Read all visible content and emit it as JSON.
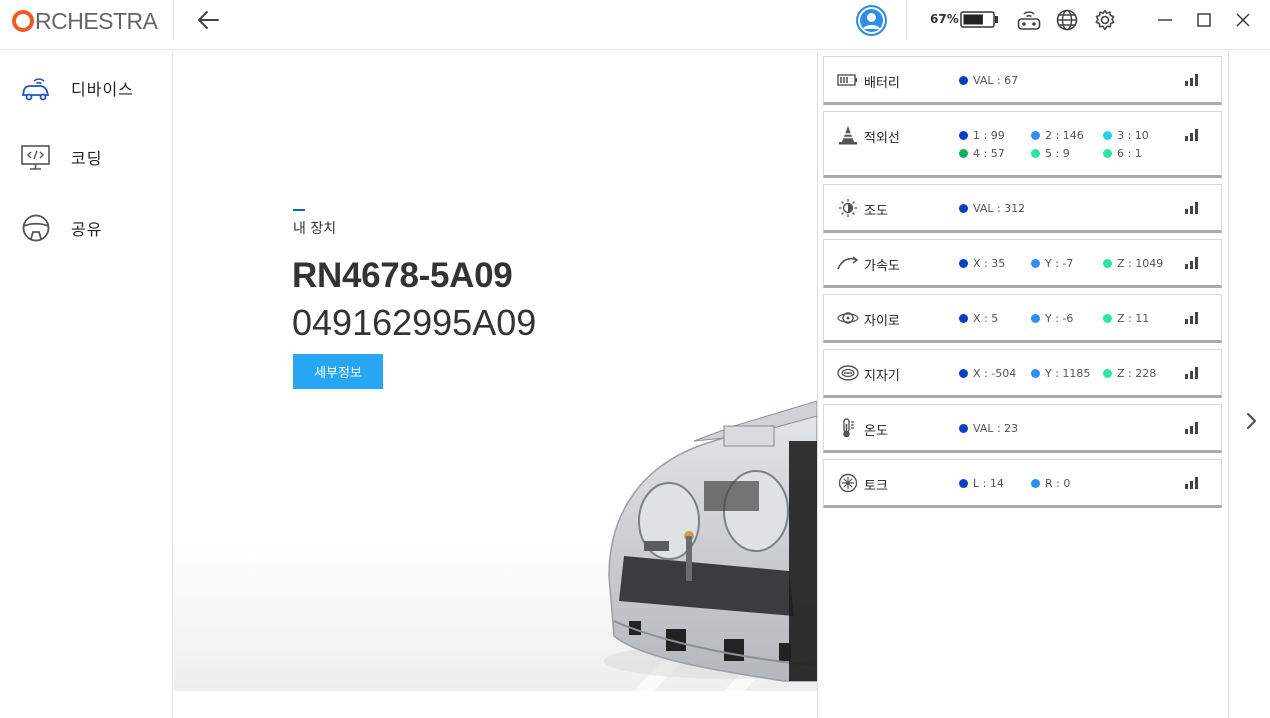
{
  "app": {
    "logo_text": "RCHESTRA"
  },
  "topbar": {
    "battery_percent": "67%",
    "battery_level": 0.67,
    "icons": [
      "back-arrow-icon",
      "user-avatar-icon",
      "battery-icon",
      "controller-icon",
      "globe-icon",
      "gear-icon",
      "minimize-icon",
      "maximize-icon",
      "close-icon"
    ]
  },
  "sidebar": {
    "items": [
      {
        "label": "디바이스",
        "icon": "device-car-icon"
      },
      {
        "label": "코딩",
        "icon": "coding-monitor-icon"
      },
      {
        "label": "공유",
        "icon": "share-steering-icon"
      }
    ]
  },
  "device": {
    "section_label": "내 장치",
    "name": "RN4678-5A09",
    "id": "049162995A09",
    "detail_button": "세부정보"
  },
  "colors": {
    "accent": "#27a7f3",
    "logo_orange": "#f15a22",
    "dot_dark_blue": "#0a3fc0",
    "dot_blue": "#2e8ff0",
    "dot_cyan": "#2ecdf0",
    "dot_green": "#0fb25a",
    "dot_teal": "#2de3a5"
  },
  "sensors": [
    {
      "name": "배터리",
      "icon": "battery-icon",
      "values": [
        {
          "text": "VAL : 67",
          "color": "dot_dark_blue"
        }
      ]
    },
    {
      "name": "적외선",
      "icon": "cone-icon",
      "values": [
        {
          "text": "1 : 99",
          "color": "dot_dark_blue"
        },
        {
          "text": "2 : 146",
          "color": "dot_blue"
        },
        {
          "text": "3 : 10",
          "color": "dot_cyan"
        },
        {
          "text": "4 : 57",
          "color": "dot_green"
        },
        {
          "text": "5 : 9",
          "color": "dot_teal"
        },
        {
          "text": "6 : 1",
          "color": "dot_teal"
        }
      ]
    },
    {
      "name": "조도",
      "icon": "sun-icon",
      "values": [
        {
          "text": "VAL : 312",
          "color": "dot_dark_blue"
        }
      ]
    },
    {
      "name": "가속도",
      "icon": "accel-curve-icon",
      "values": [
        {
          "text": "X : 35",
          "color": "dot_dark_blue"
        },
        {
          "text": "Y : -7",
          "color": "dot_blue"
        },
        {
          "text": "Z : 1049",
          "color": "dot_teal"
        }
      ]
    },
    {
      "name": "자이로",
      "icon": "gyro-icon",
      "values": [
        {
          "text": "X : 5",
          "color": "dot_dark_blue"
        },
        {
          "text": "Y : -6",
          "color": "dot_blue"
        },
        {
          "text": "Z : 11",
          "color": "dot_teal"
        }
      ]
    },
    {
      "name": "지자기",
      "icon": "magnet-icon",
      "values": [
        {
          "text": "X : -504",
          "color": "dot_dark_blue"
        },
        {
          "text": "Y : 1185",
          "color": "dot_blue"
        },
        {
          "text": "Z : 228",
          "color": "dot_teal"
        }
      ]
    },
    {
      "name": "온도",
      "icon": "thermometer-icon",
      "values": [
        {
          "text": "VAL : 23",
          "color": "dot_dark_blue"
        }
      ]
    },
    {
      "name": "토크",
      "icon": "torque-icon",
      "values": [
        {
          "text": "L : 14",
          "color": "dot_dark_blue"
        },
        {
          "text": "R : 0",
          "color": "dot_blue"
        }
      ]
    }
  ]
}
